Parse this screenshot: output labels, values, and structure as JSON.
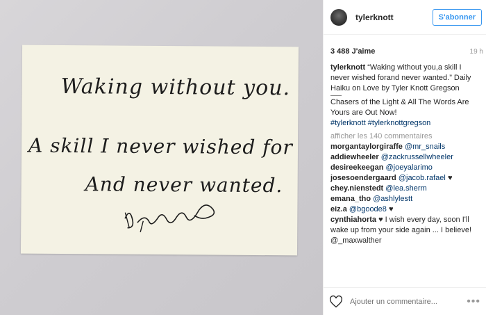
{
  "photo": {
    "note_lines": [
      "Waking without you.",
      "A skill I never wished for",
      "And never wanted."
    ]
  },
  "header": {
    "username": "tylerknott",
    "follow_label": "S'abonner"
  },
  "stats": {
    "likes": "3 488 J'aime",
    "time": "19 h"
  },
  "caption": {
    "username": "tylerknott",
    "text": "“Waking without you,a skill I never wished forand never wanted.” Daily Haiku on Love by Tyler Knott Gregson",
    "promo": "Chasers of the Light & All The Words Are Yours are Out Now!",
    "hashtags": "#tylerknott #tylerknottgregson"
  },
  "more_comments": "afficher les 140 commentaires",
  "comments": [
    {
      "user": "morgantaylorgiraffe",
      "mention": "@mr_snails",
      "suffix": ""
    },
    {
      "user": "addiewheeler",
      "mention": "@zackrussellwheeler",
      "suffix": ""
    },
    {
      "user": "desireekeegan",
      "mention": "@joeyalarimo",
      "suffix": ""
    },
    {
      "user": "josesoendergaard",
      "mention": "@jacob.rafael",
      "suffix": "♥"
    },
    {
      "user": "chey.nienstedt",
      "mention": "@lea.sherm",
      "suffix": ""
    },
    {
      "user": "emana_tho",
      "mention": "@ashlylestt",
      "suffix": ""
    },
    {
      "user": "eiz.a",
      "mention": "@bgoode8",
      "suffix": "♥"
    }
  ],
  "last_comment": {
    "user": "cynthiahorta",
    "text": "♥ I wish every day, soon I'll wake up from your side again ... I believe! @_maxwalther"
  },
  "footer": {
    "placeholder": "Ajouter un commentaire..."
  }
}
